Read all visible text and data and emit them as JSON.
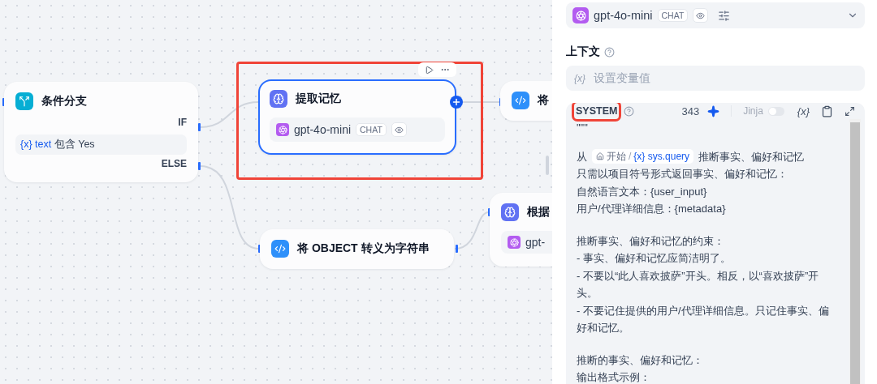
{
  "canvas": {
    "nodes": [
      {
        "kind": "condition",
        "title": "条件分支",
        "selected": false,
        "highlighted": false,
        "if_label": "IF",
        "condition": {
          "var_icon": "{x}",
          "variable": "text",
          "operator": "包含",
          "value": "Yes"
        },
        "else_label": "ELSE"
      },
      {
        "kind": "llm",
        "title": "提取记忆",
        "selected": true,
        "highlighted": true,
        "model": {
          "name": "gpt-4o-mini",
          "badge": "CHAT"
        }
      },
      {
        "kind": "code",
        "title": "将",
        "selected": false,
        "highlighted": false
      },
      {
        "kind": "code",
        "title": "将 OBJECT 转义为字符串",
        "selected": false,
        "highlighted": false
      },
      {
        "kind": "llm",
        "title": "根据",
        "selected": false,
        "highlighted": false,
        "model": {
          "name": "gpt-"
        }
      }
    ]
  },
  "panel": {
    "model": {
      "name": "gpt-4o-mini",
      "badge": "CHAT"
    },
    "context": {
      "label": "上下文",
      "var_icon": "{x}",
      "placeholder": "设置变量值"
    },
    "prompt": {
      "role": "SYSTEM",
      "highlighted": true,
      "count": "343",
      "jinja": {
        "label": "Jinja",
        "on": false,
        "disabled": true
      },
      "var_button": "{x}",
      "paragraphs": [
        [
          {
            "kind": "text",
            "text": "\"\"\""
          }
        ],
        [
          {
            "kind": "reference",
            "before": "从",
            "node": "开始",
            "separator": "/",
            "var_icon": "{x}",
            "variable": "sys.query",
            "after": "推断事实、偏好和记忆"
          },
          {
            "kind": "text",
            "text": "只需以项目符号形式返回事实、偏好和记忆："
          },
          {
            "kind": "text",
            "text": "自然语言文本：{user_input}"
          },
          {
            "kind": "text",
            "text": "用户/代理详细信息：{metadata}"
          }
        ],
        [
          {
            "kind": "text",
            "text": "推断事实、偏好和记忆的约束："
          },
          {
            "kind": "text",
            "text": "- 事实、偏好和记忆应简洁明了。"
          },
          {
            "kind": "text",
            "text": "- 不要以“此人喜欢披萨”开头。相反，以“喜欢披萨”开头。"
          },
          {
            "kind": "text",
            "text": "- 不要记住提供的用户/代理详细信息。只记住事实、偏好和记忆。"
          }
        ],
        [
          {
            "kind": "text",
            "text": "推断的事实、偏好和记忆："
          },
          {
            "kind": "text",
            "text": "输出格式示例："
          }
        ]
      ]
    }
  }
}
